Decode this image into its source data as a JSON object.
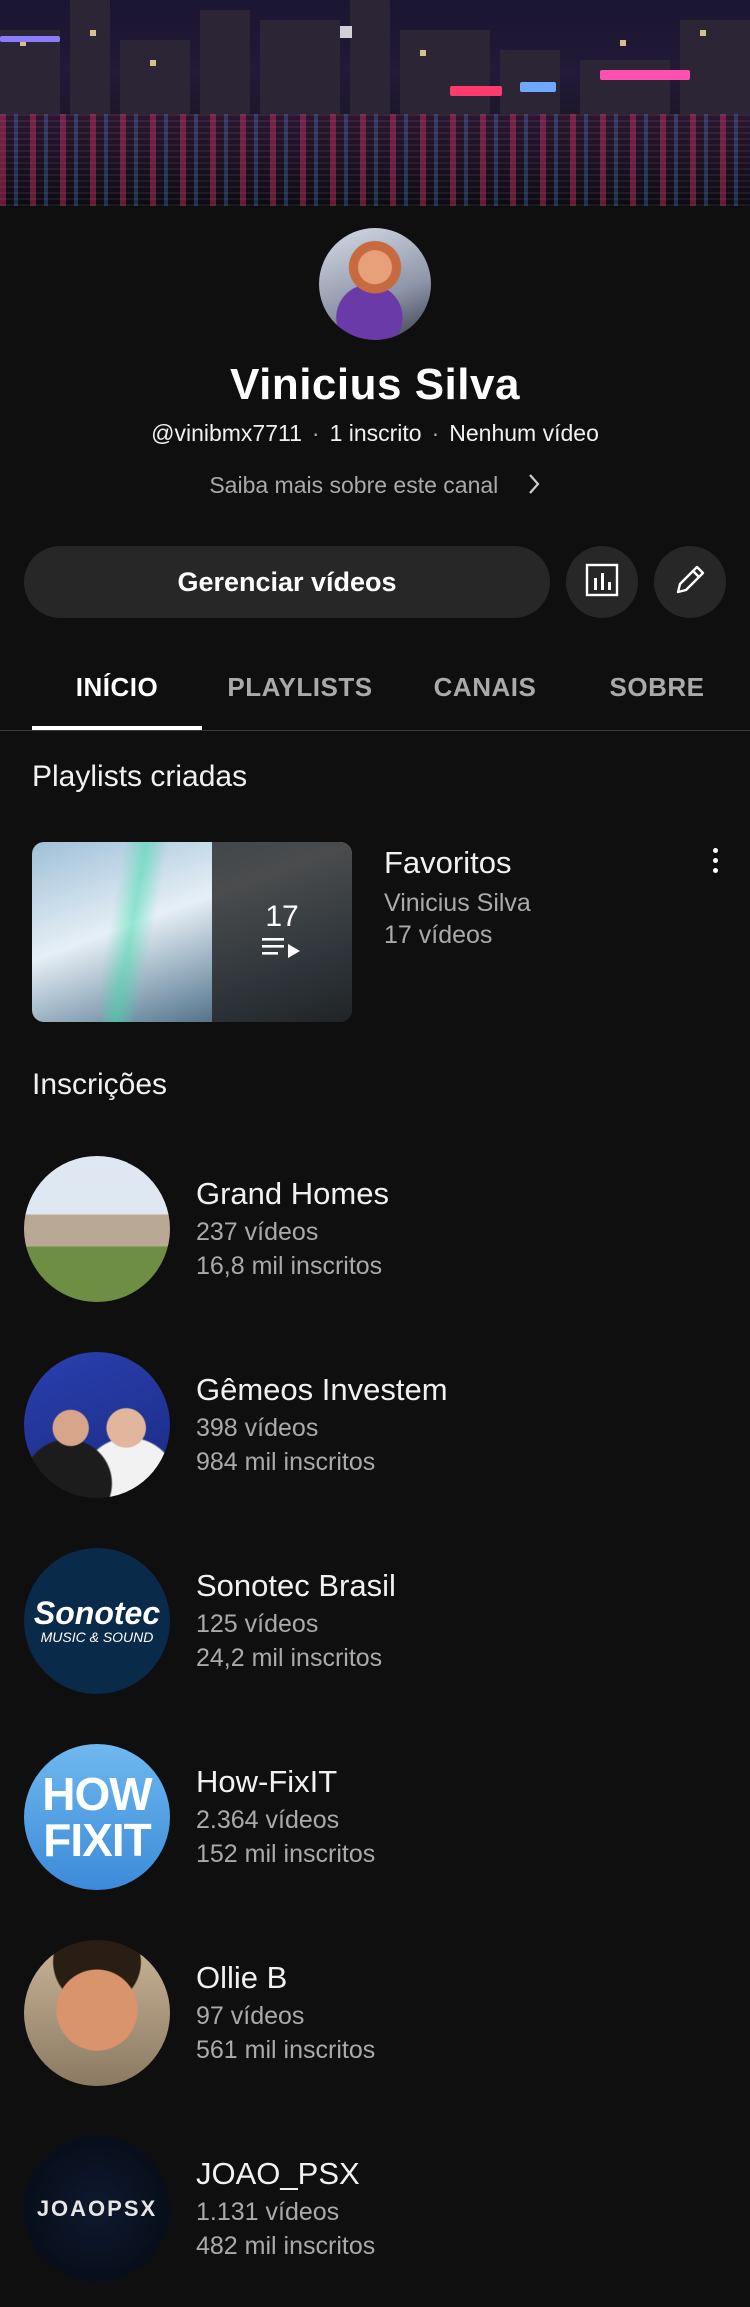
{
  "channel": {
    "name": "Vinicius Silva",
    "handle": "@vinibmx7711",
    "subscribers": "1 inscrito",
    "videos": "Nenhum vídeo",
    "more_link": "Saiba mais sobre este canal"
  },
  "actions": {
    "manage_label": "Gerenciar vídeos",
    "analytics_icon": "bar-chart-icon",
    "edit_icon": "pencil-icon"
  },
  "tabs": [
    {
      "label": "INÍCIO",
      "active": true
    },
    {
      "label": "PLAYLISTS",
      "active": false
    },
    {
      "label": "CANAIS",
      "active": false
    },
    {
      "label": "SOBRE",
      "active": false
    }
  ],
  "playlists_section": {
    "title": "Playlists criadas",
    "items": [
      {
        "title": "Favoritos",
        "owner": "Vinicius Silva",
        "count_label": "17 vídeos",
        "thumb_count": "17"
      }
    ]
  },
  "subscriptions_section": {
    "title": "Inscrições",
    "items": [
      {
        "name": "Grand Homes",
        "videos": "237 vídeos",
        "subs": "16,8 mil inscritos"
      },
      {
        "name": "Gêmeos Investem",
        "videos": "398 vídeos",
        "subs": "984 mil inscritos"
      },
      {
        "name": "Sonotec Brasil",
        "videos": "125 vídeos",
        "subs": "24,2 mil inscritos"
      },
      {
        "name": "How-FixIT",
        "videos": "2.364 vídeos",
        "subs": "152 mil inscritos"
      },
      {
        "name": "Ollie B",
        "videos": "97 vídeos",
        "subs": "561 mil inscritos"
      },
      {
        "name": "JOAO_PSX",
        "videos": "1.131 vídeos",
        "subs": "482 mil inscritos"
      }
    ]
  },
  "avatar_text": {
    "sonotec_1": "Sonotec",
    "sonotec_2": "MUSIC & SOUND",
    "howfix_1": "HOW",
    "howfix_2": "FIXIT",
    "joao": "JOAOPSX"
  },
  "colors": {
    "background": "#0f0f0f",
    "surface": "#272727",
    "text_primary": "#f1f1f1",
    "text_secondary": "#aaaaaa"
  }
}
